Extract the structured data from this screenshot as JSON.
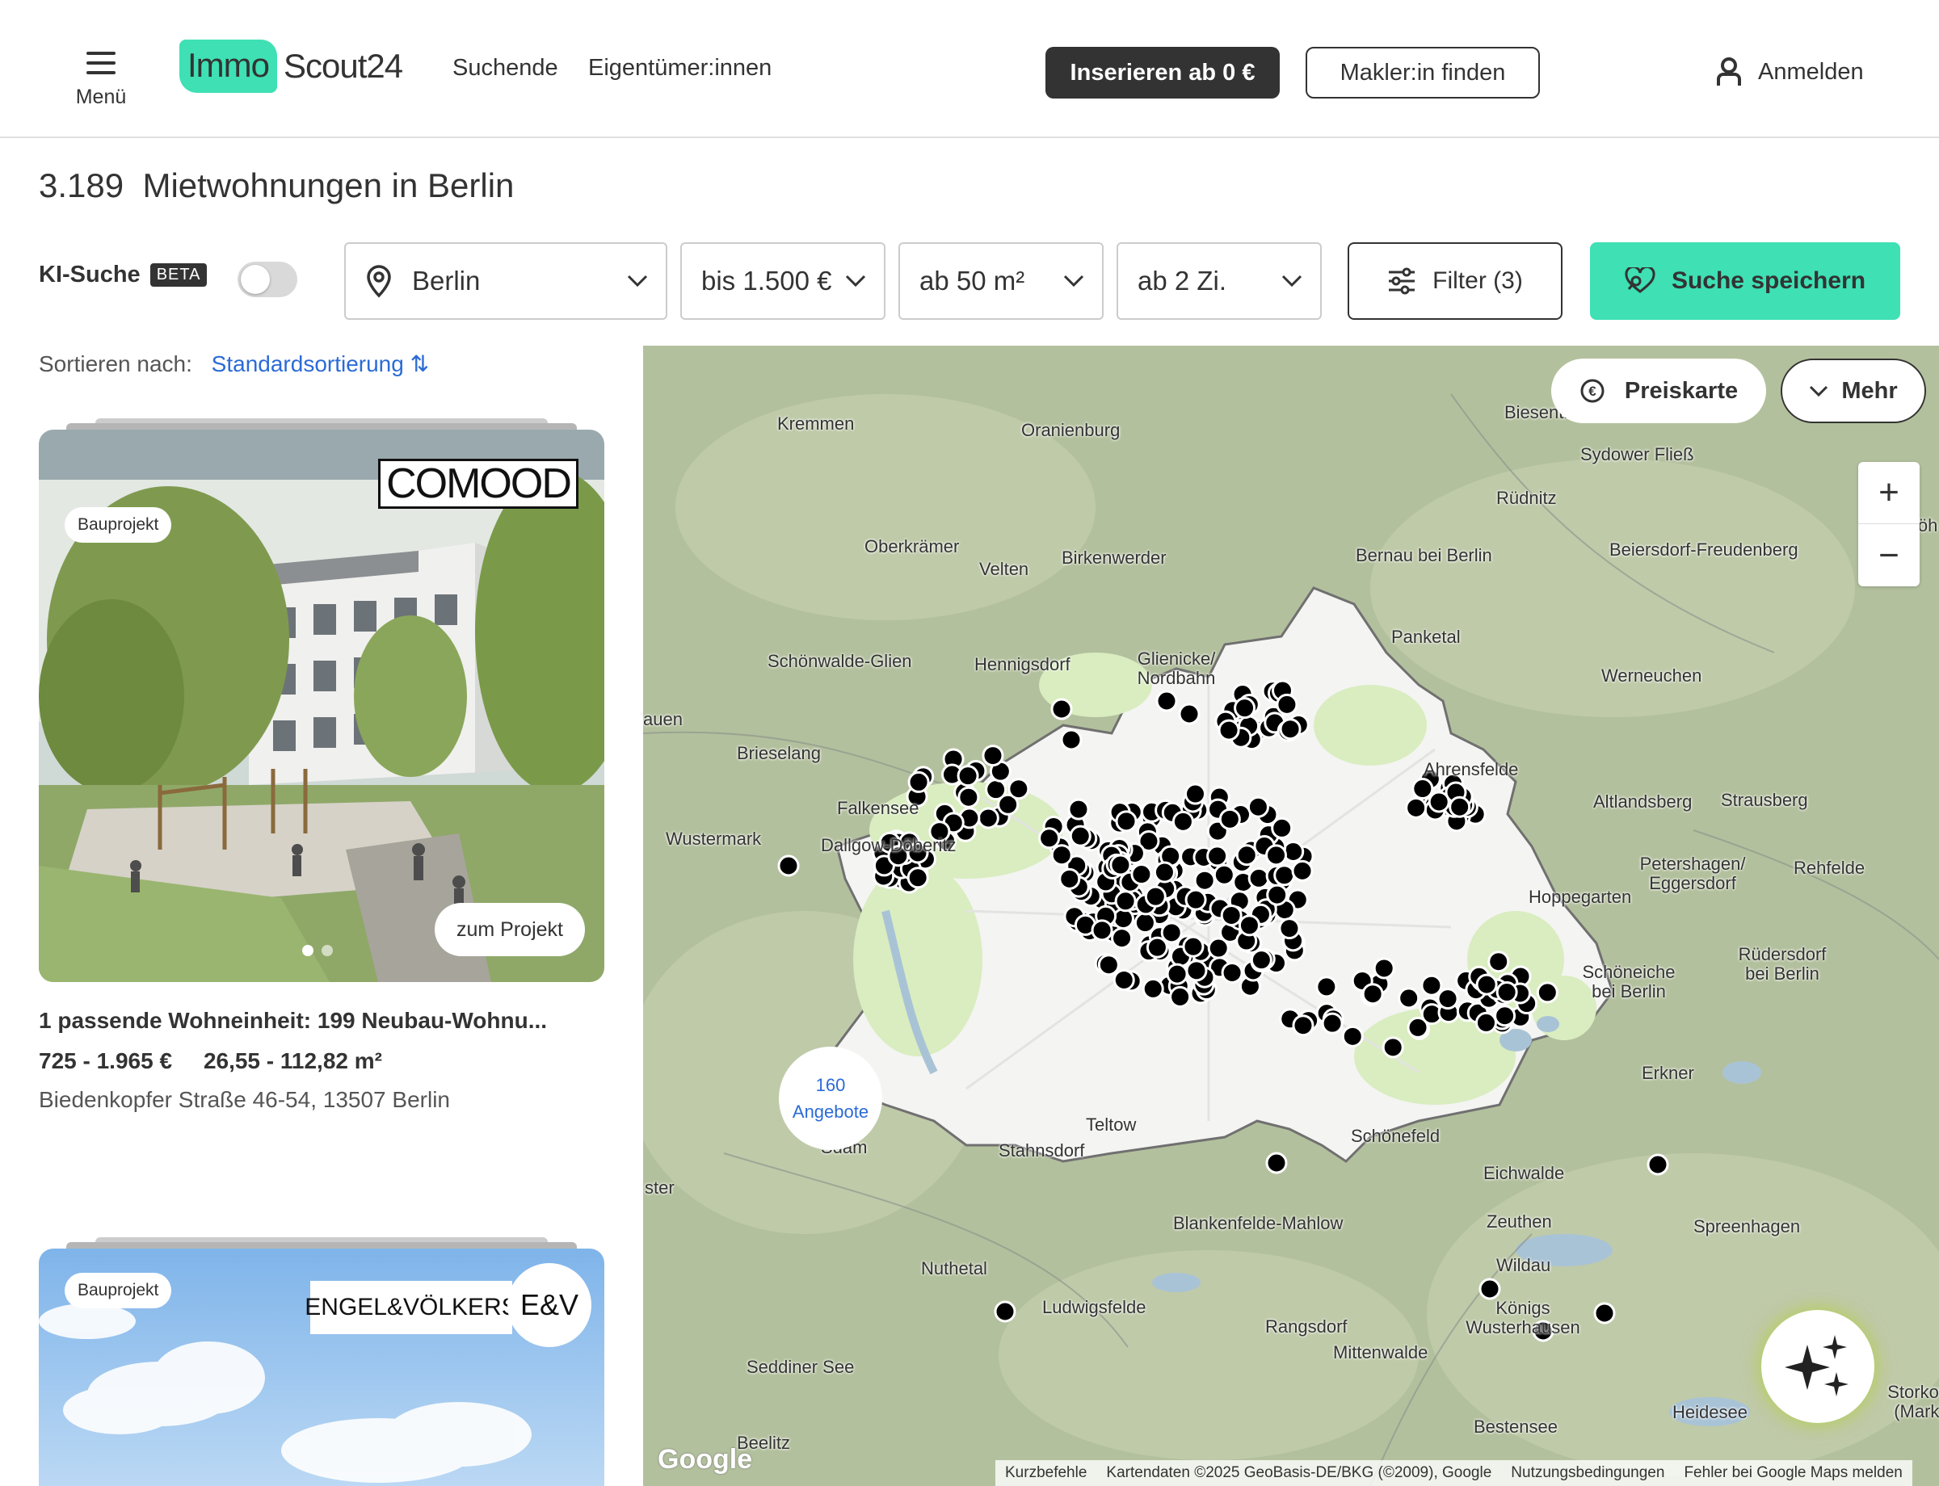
{
  "header": {
    "menu_label": "Menü",
    "logo_part1": "Immo",
    "logo_part2": "Scout24",
    "nav": [
      "Suchende",
      "Eigentümer:innen"
    ],
    "insert_button": "Inserieren ab 0 €",
    "agent_button": "Makler:in finden",
    "login": "Anmelden"
  },
  "page_title": {
    "count": "3.189",
    "text": "Mietwohnungen in Berlin"
  },
  "search": {
    "ki_label": "KI-Suche",
    "beta": "BETA",
    "ki_enabled": false,
    "location": "Berlin",
    "price": "bis 1.500 €",
    "area": "ab 50 m²",
    "rooms": "ab 2 Zi.",
    "filter_button": "Filter (3)",
    "save_button": "Suche speichern"
  },
  "sort": {
    "label": "Sortieren nach:",
    "value": "Standardsortierung ⇅"
  },
  "listings": [
    {
      "badge": "Bauprojekt",
      "brand": "COMOOD",
      "cta": "zum Projekt",
      "title": "1 passende Wohneinheit: 199 Neubau-Wohnu...",
      "price": "725 - 1.965 €",
      "area": "26,55 - 112,82 m²",
      "address": "Biedenkopfer Straße 46-54, 13507 Berlin"
    },
    {
      "badge": "Bauprojekt",
      "brand": "ENGEL&VÖLKERS",
      "brand_short": "E&V"
    }
  ],
  "map": {
    "preiskarte_button": "Preiskarte",
    "more_button": "Mehr",
    "zoom_in": "+",
    "zoom_out": "−",
    "cluster_count": "160",
    "cluster_label": "Angebote",
    "google": "Google",
    "places": [
      "Kremmen",
      "Oranienburg",
      "Biesenthal",
      "Sydower Fließ",
      "Rüdnitz",
      "Oberkrämer",
      "Velten",
      "Birkenwerder",
      "Bernau bei Berlin",
      "Beiersdorf-Freudenberg",
      "Glienicke/ Nordbahn",
      "Panketal",
      "Schönwalde-Glien",
      "Hennigsdorf",
      "Werneuchen",
      "Brieselang",
      "Ahrensfelde",
      "Falkensee",
      "Altlandsberg",
      "Strausberg",
      "Wustermark",
      "Dallgow-Döberitz",
      "Petershagen/ Eggersdorf",
      "Rehfelde",
      "Hoppegarten",
      "Rüdersdorf bei Berlin",
      "Schöneiche bei Berlin",
      "Erkner",
      "Teltow",
      "Stahnsdorf",
      "Schönefeld",
      "Eichwalde",
      "Blankenfelde-Mahlow",
      "Zeuthen",
      "Spreenhagen",
      "Nuthetal",
      "Wildau",
      "Ludwigsfelde",
      "Königs Wusterhausen",
      "Rangsdorf",
      "Mittenwalde",
      "Seddiner See",
      "Heidesee",
      "Bestensee",
      "Beelitz",
      "Storkow (Mark)",
      "Höh",
      "Sdam",
      "ster",
      "auen"
    ],
    "attribution": [
      "Kurzbefehle",
      "Kartendaten ©2025 GeoBasis-DE/BKG (©2009), Google",
      "Nutzungsbedingungen",
      "Fehler bei Google Maps melden"
    ]
  }
}
